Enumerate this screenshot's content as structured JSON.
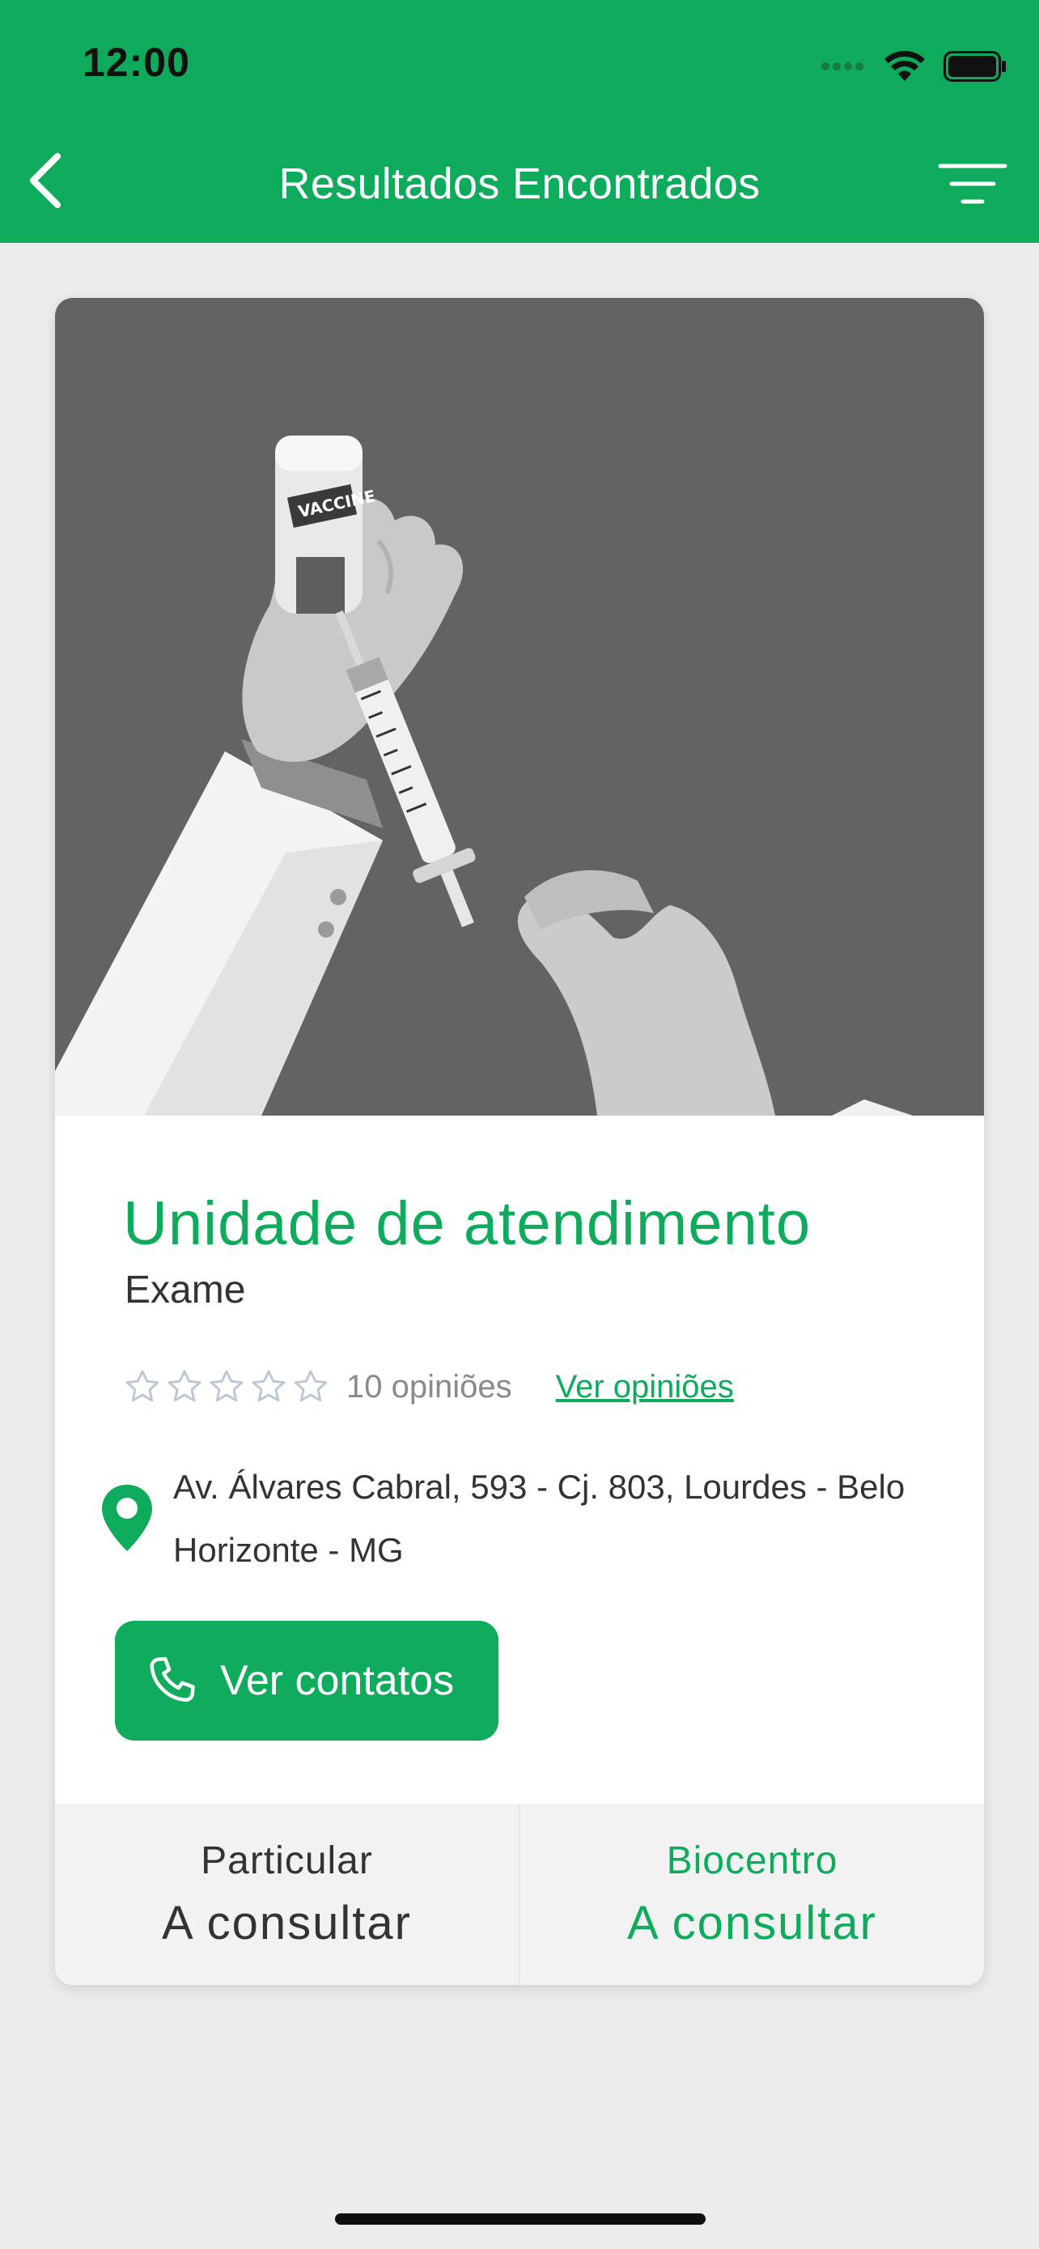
{
  "status_bar": {
    "time": "12:00",
    "icons": [
      "signal-dots-icon",
      "wifi-icon",
      "battery-icon"
    ]
  },
  "nav": {
    "title": "Resultados Encontrados",
    "back_icon": "chevron-left-icon",
    "filter_icon": "filter-icon"
  },
  "card": {
    "image": {
      "icon": "vaccine-syringe-illustration",
      "vial_label": "VACCINE"
    },
    "title": "Unidade de atendimento",
    "subtitle": "Exame",
    "rating": {
      "stars_filled": 0,
      "stars_total": 5,
      "opinions_count": "10 opiniões",
      "opinions_link": "Ver opiniões"
    },
    "address": "Av. Álvares Cabral, 593 - Cj. 803, Lourdes - Belo Horizonte - MG",
    "contact_button": "Ver contatos",
    "footer": {
      "left": {
        "label": "Particular",
        "value": "A consultar"
      },
      "right": {
        "label": "Biocentro",
        "value": "A consultar"
      }
    }
  },
  "colors": {
    "primary": "#0dab5b",
    "background": "#ebebeb",
    "image_bg": "#636363",
    "text": "#333333",
    "muted": "#8a8a8a",
    "footer_bg": "#f2f2f2"
  }
}
